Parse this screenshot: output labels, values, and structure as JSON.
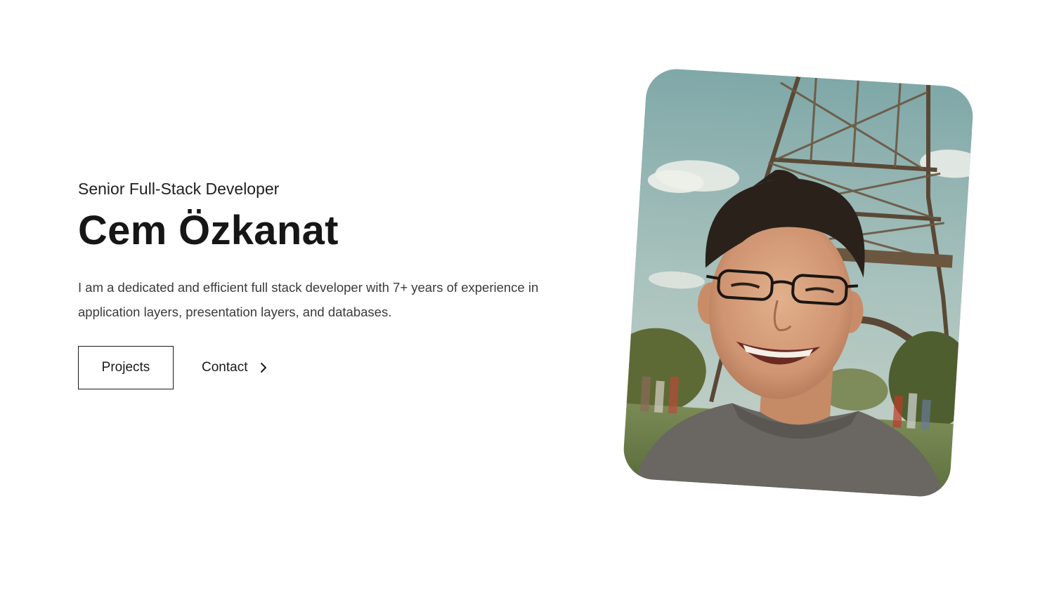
{
  "hero": {
    "subtitle": "Senior Full-Stack Developer",
    "name": "Cem Özkanat",
    "bio": "I am a dedicated and efficient full stack developer with 7+ years of experience in application layers, presentation layers, and databases."
  },
  "actions": {
    "projects_label": "Projects",
    "contact_label": "Contact",
    "contact_icon": "chevron-right-icon"
  },
  "photo": {
    "alt": "Portrait photo in front of the Eiffel Tower"
  },
  "colors": {
    "text": "#1a1a1a",
    "body_text": "#3a3a3a",
    "background": "#ffffff"
  }
}
